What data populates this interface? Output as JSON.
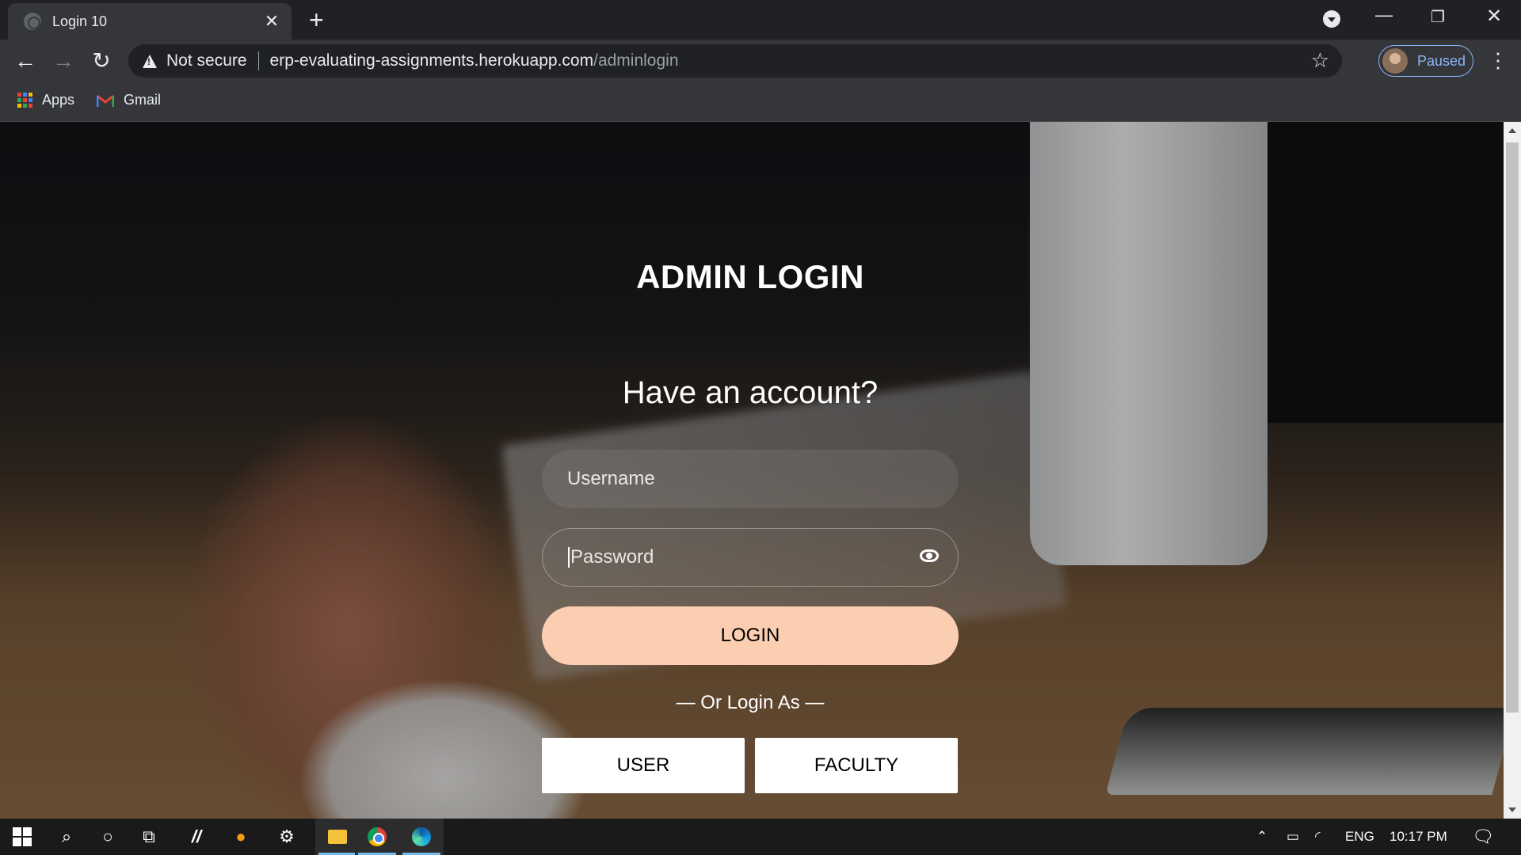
{
  "browser": {
    "tab_title": "Login 10",
    "tab_close": "✕",
    "new_tab": "+",
    "security_label": "Not secure",
    "url_host": "erp-evaluating-assignments.herokuapp.com",
    "url_path": "/adminlogin",
    "profile_status": "Paused",
    "bookmarks": [
      {
        "label": "Apps",
        "icon": "apps-grid-icon"
      },
      {
        "label": "Gmail",
        "icon": "gmail-icon"
      }
    ]
  },
  "login": {
    "title": "ADMIN LOGIN",
    "subtitle": "Have an account?",
    "username_placeholder": "Username",
    "password_placeholder": "Password",
    "login_button": "LOGIN",
    "or_login_as": "— Or Login As —",
    "user_button": "USER",
    "faculty_button": "FACULTY",
    "accent_color": "#fbceb1"
  },
  "taskbar": {
    "language": "ENG",
    "time": "10:17 PM"
  }
}
